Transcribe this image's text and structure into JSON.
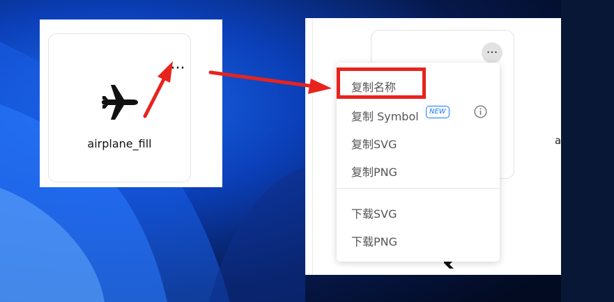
{
  "left_panel": {
    "icon_name": "airplane_fill",
    "more_label": "···"
  },
  "right_panel": {
    "more_label": "···",
    "partial_label": "a"
  },
  "menu": {
    "items": [
      {
        "label": "复制名称"
      },
      {
        "label": "复制 Symbol",
        "badge": "NEW"
      },
      {
        "label": "复制SVG"
      },
      {
        "label": "复制PNG"
      },
      {
        "label": "下载SVG"
      },
      {
        "label": "下载PNG"
      }
    ]
  },
  "colors": {
    "highlight": "#e8231c",
    "badge": "#1677ff",
    "menu_text": "#555555"
  }
}
